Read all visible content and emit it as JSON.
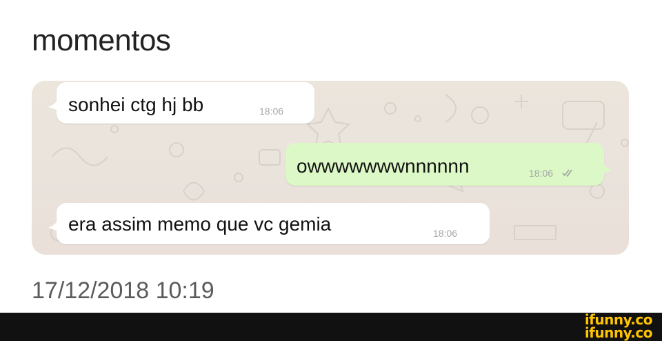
{
  "post": {
    "title": "momentos",
    "date": "17/12/2018 10:19"
  },
  "chat": {
    "messages": [
      {
        "direction": "incoming",
        "text": "sonhei ctg hj bb",
        "time": "18:06"
      },
      {
        "direction": "outgoing",
        "text": "owwwwwwwnnnnnn",
        "time": "18:06",
        "status_icon": "double-check-icon"
      },
      {
        "direction": "incoming",
        "text": "era assim memo que vc gemia",
        "time": "18:06"
      }
    ]
  },
  "watermark": {
    "text": "ifunny.co",
    "color": "#ffc400"
  },
  "colors": {
    "incoming_bubble": "#ffffff",
    "outgoing_bubble": "#dcf8c6",
    "chat_background": "#ece5dc"
  }
}
